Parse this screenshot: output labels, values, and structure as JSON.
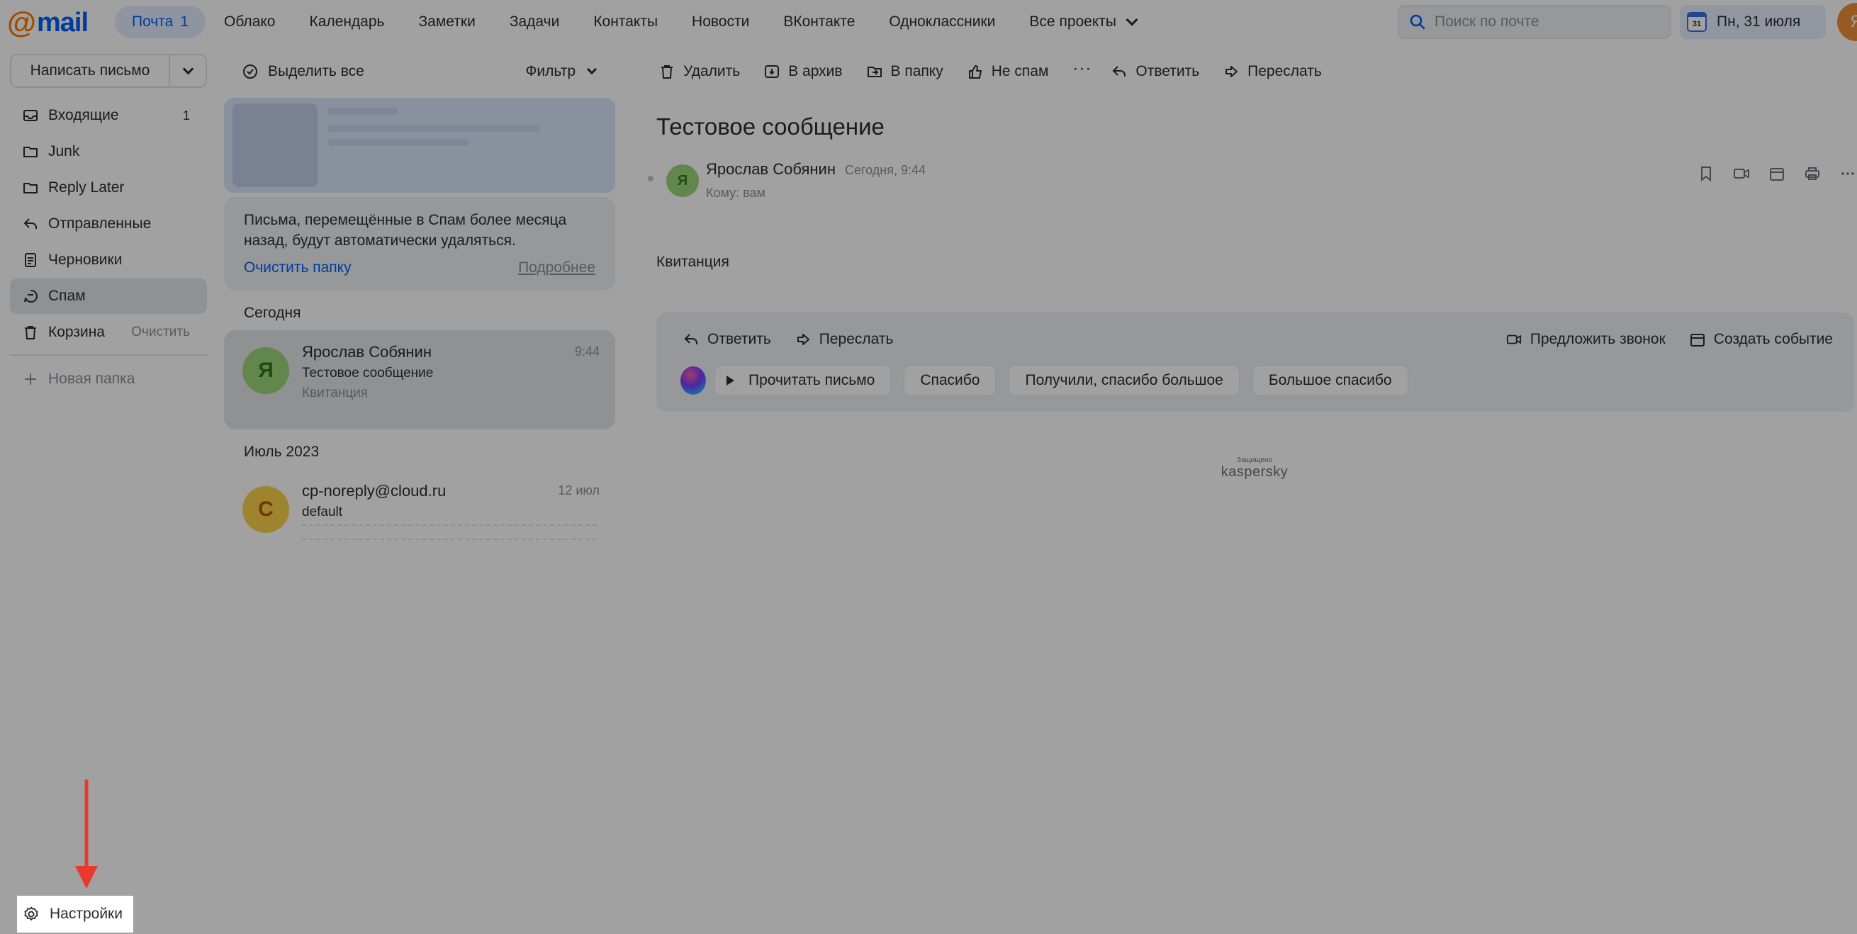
{
  "logo": {
    "at": "@",
    "word": "mail"
  },
  "nav": {
    "items": [
      {
        "label": "Почта",
        "count": "1"
      },
      {
        "label": "Облако"
      },
      {
        "label": "Календарь"
      },
      {
        "label": "Заметки"
      },
      {
        "label": "Задачи"
      },
      {
        "label": "Контакты"
      },
      {
        "label": "Новости"
      },
      {
        "label": "ВКонтакте"
      },
      {
        "label": "Одноклассники"
      },
      {
        "label": "Все проекты"
      }
    ]
  },
  "search": {
    "placeholder": "Поиск по почте"
  },
  "date": {
    "day": "31",
    "label": "Пн, 31 июля"
  },
  "user_avatar": "Я",
  "compose": {
    "label": "Написать письмо"
  },
  "folders": [
    {
      "label": "Входящие",
      "count": "1",
      "icon": "inbox-icon"
    },
    {
      "label": "Junk",
      "icon": "folder-icon"
    },
    {
      "label": "Reply Later",
      "icon": "folder-icon"
    },
    {
      "label": "Отправленные",
      "icon": "sent-icon"
    },
    {
      "label": "Черновики",
      "icon": "drafts-icon"
    },
    {
      "label": "Спам",
      "icon": "spam-icon",
      "active": true
    },
    {
      "label": "Корзина",
      "icon": "trash-icon",
      "action": "Очистить"
    }
  ],
  "new_folder": "Новая папка",
  "settings": "Настройки",
  "list": {
    "select_all": "Выделить все",
    "filter": "Фильтр",
    "notice": {
      "text": "Письма, перемещённые в Спам более месяца назад, будут автоматически удаляться.",
      "clear_link": "Очистить папку",
      "more_link": "Подробнее"
    },
    "groups": [
      {
        "title": "Сегодня",
        "messages": [
          {
            "avatar": "Я",
            "from": "Ярослав Собянин",
            "subject": "Тестовое сообщение",
            "snippet": "Квитанция",
            "time": "9:44"
          }
        ]
      },
      {
        "title": "Июль 2023",
        "messages": [
          {
            "avatar": "C",
            "from": "cp-noreply@cloud.ru",
            "subject": "default",
            "time": "12 июл"
          }
        ]
      }
    ]
  },
  "toolbar": {
    "delete": "Удалить",
    "archive": "В архив",
    "to_folder": "В папку",
    "not_spam": "Не спам",
    "more": "···",
    "reply": "Ответить",
    "forward": "Переслать"
  },
  "message": {
    "subject": "Тестовое сообщение",
    "avatar": "Я",
    "sender": "Ярослав Собянин",
    "when": "Сегодня, 9:44",
    "to": "Кому: вам",
    "body": "Квитанция"
  },
  "reply_box": {
    "reply": "Ответить",
    "forward": "Переслать",
    "call": "Предложить звонок",
    "event": "Создать событие",
    "read_aloud": "Прочитать письмо",
    "quick_replies": [
      "Спасибо",
      "Получили, спасибо большое",
      "Большое спасибо"
    ]
  },
  "protection": {
    "small": "Защищено",
    "brand": "kaspersky"
  },
  "colors": {
    "accent": "#005ff9",
    "logo_orange": "#ff7a00",
    "annotation_arrow": "#e8392c"
  }
}
